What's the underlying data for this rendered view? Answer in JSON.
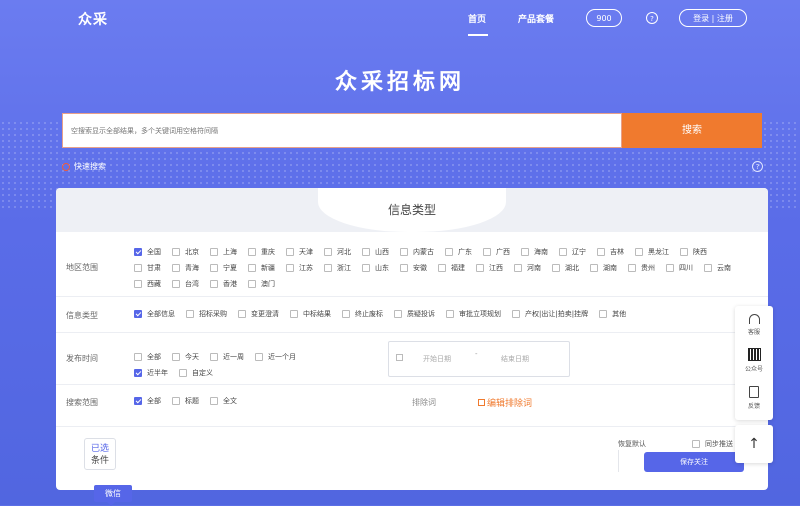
{
  "header": {
    "logo": "众采",
    "nav_home": "首页",
    "nav_products": "产品套餐",
    "badge_count": "900",
    "help": "?",
    "login_register": "登录 | 注册"
  },
  "hero": {
    "title": "众采招标网"
  },
  "search": {
    "placeholder": "空搜索显示全部结果，多个关键词用空格符间隔",
    "button": "搜索",
    "quick_search": "快速搜索",
    "help": "?"
  },
  "panel": {
    "title": "信息类型",
    "region": {
      "label": "地区范围",
      "options": [
        {
          "label": "全国",
          "checked": true
        },
        {
          "label": "北京"
        },
        {
          "label": "上海"
        },
        {
          "label": "重庆"
        },
        {
          "label": "天津"
        },
        {
          "label": "河北"
        },
        {
          "label": "山西"
        },
        {
          "label": "内蒙古"
        },
        {
          "label": "广东"
        },
        {
          "label": "广西"
        },
        {
          "label": "海南"
        },
        {
          "label": "辽宁"
        },
        {
          "label": "吉林"
        },
        {
          "label": "黑龙江"
        },
        {
          "label": "陕西"
        },
        {
          "label": "甘肃"
        },
        {
          "label": "青海"
        },
        {
          "label": "宁夏"
        },
        {
          "label": "新疆"
        },
        {
          "label": "江苏"
        },
        {
          "label": "浙江"
        },
        {
          "label": "山东"
        },
        {
          "label": "安徽"
        },
        {
          "label": "福建"
        },
        {
          "label": "江西"
        },
        {
          "label": "河南"
        },
        {
          "label": "湖北"
        },
        {
          "label": "湖南"
        },
        {
          "label": "贵州"
        },
        {
          "label": "四川"
        },
        {
          "label": "云南"
        },
        {
          "label": "西藏"
        },
        {
          "label": "台湾"
        },
        {
          "label": "香港"
        },
        {
          "label": "澳门"
        }
      ]
    },
    "info_type": {
      "label": "信息类型",
      "options": [
        {
          "label": "全部信息",
          "checked": true
        },
        {
          "label": "招标采购"
        },
        {
          "label": "变更澄清"
        },
        {
          "label": "中标结果"
        },
        {
          "label": "终止废标"
        },
        {
          "label": "质疑投诉"
        },
        {
          "label": "审批立项规划"
        },
        {
          "label": "产权|出让|拍卖|挂牌"
        },
        {
          "label": "其他"
        }
      ]
    },
    "publish_time": {
      "label": "发布时间",
      "options": [
        {
          "label": "全部"
        },
        {
          "label": "今天"
        },
        {
          "label": "近一周"
        },
        {
          "label": "近一个月"
        },
        {
          "label": "近半年",
          "checked": true
        },
        {
          "label": "自定义"
        }
      ],
      "start_placeholder": "开始日期",
      "separator": "-",
      "end_placeholder": "结束日期"
    },
    "search_scope": {
      "label": "搜索范围",
      "options": [
        {
          "label": "全部",
          "checked": true
        },
        {
          "label": "标题"
        },
        {
          "label": "全文"
        }
      ],
      "exclude_label": "排除词",
      "exclude_edit": "编辑排除词"
    },
    "selected_line1": "已选",
    "selected_line2": "条件",
    "restore_default": "恢复默认",
    "sync_push": "同步推送",
    "save_follow": "保存关注"
  },
  "wechat": "微信",
  "sidebar": {
    "service": "客服",
    "official_account": "公众号",
    "feedback": "反馈",
    "back_top": "↑"
  },
  "colors": {
    "brand": "#5666e8",
    "accent": "#f07a2e"
  }
}
